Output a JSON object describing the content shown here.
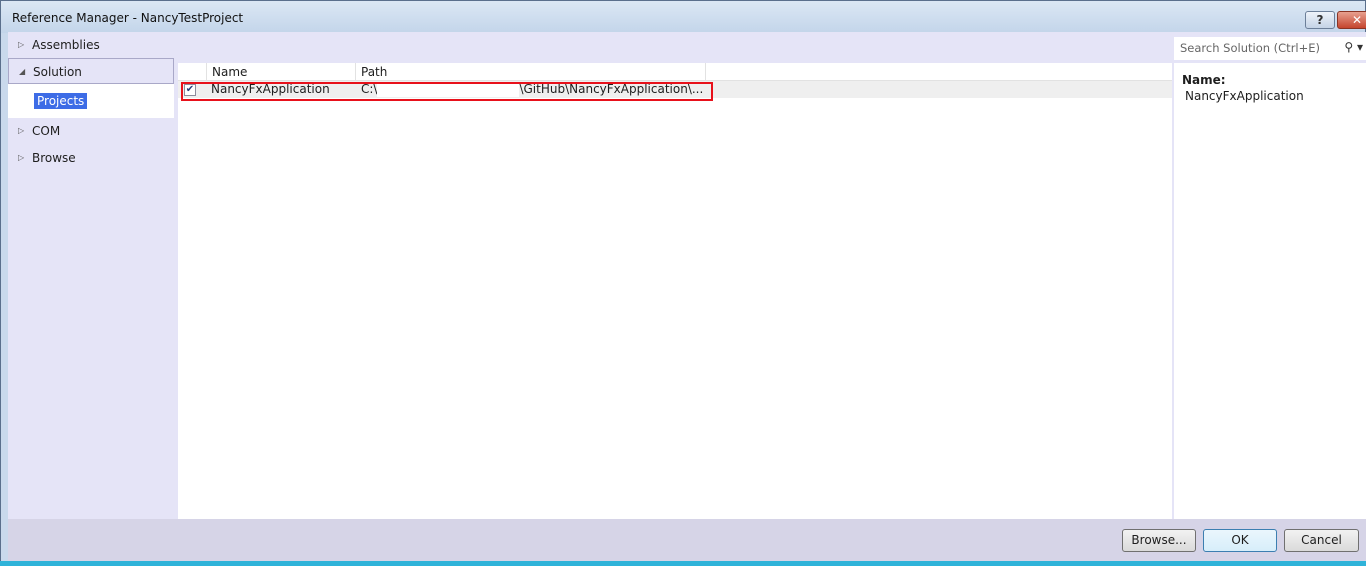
{
  "window": {
    "title": "Reference Manager - NancyTestProject",
    "help_label": "?",
    "close_label": "✕"
  },
  "sidebar": {
    "items": [
      {
        "label": "Assemblies",
        "expanded": false
      },
      {
        "label": "Solution",
        "expanded": true,
        "children": [
          "Projects"
        ]
      },
      {
        "label": "COM",
        "expanded": false
      },
      {
        "label": "Browse",
        "expanded": false
      }
    ]
  },
  "search": {
    "placeholder": "Search Solution (Ctrl+E)",
    "icon": "search-icon"
  },
  "list": {
    "columns": [
      "Name",
      "Path"
    ],
    "rows": [
      {
        "checked": true,
        "name": "NancyFxApplication",
        "path_start": "C:\\",
        "path_end": "\\GitHub\\NancyFxApplication\\..."
      }
    ]
  },
  "details": {
    "label": "Name:",
    "value": "NancyFxApplication"
  },
  "buttons": {
    "browse": "Browse...",
    "ok": "OK",
    "cancel": "Cancel"
  },
  "colors": {
    "highlight": "#e8111b",
    "selection": "#3d6ce6"
  }
}
